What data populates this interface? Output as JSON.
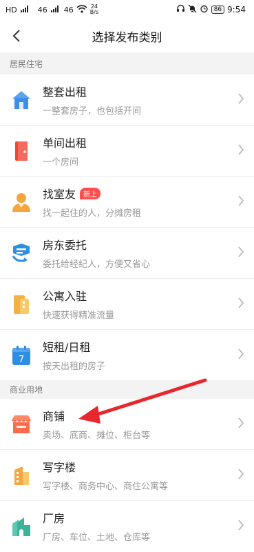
{
  "status_bar": {
    "left_labels": [
      "HD",
      "46",
      "46"
    ],
    "speed_value": "24",
    "speed_unit": "B/s",
    "battery": "86",
    "time": "9:54"
  },
  "header": {
    "title": "选择发布类别"
  },
  "sections": [
    {
      "title": "居民住宅",
      "items": [
        {
          "icon": "house-icon",
          "label": "整套出租",
          "sub": "一整套房子，也包括开间",
          "badge": ""
        },
        {
          "icon": "door-icon",
          "label": "单间出租",
          "sub": "一个房间",
          "badge": ""
        },
        {
          "icon": "person-icon",
          "label": "找室友",
          "sub": "找一起住的人，分摊房租",
          "badge": "新上"
        },
        {
          "icon": "handshake-icon",
          "label": "房东委托",
          "sub": "委托给经纪人，方便又省心",
          "badge": ""
        },
        {
          "icon": "apartment-icon",
          "label": "公寓入驻",
          "sub": "快速获得精准流量",
          "badge": ""
        },
        {
          "icon": "calendar-icon",
          "label": "短租/日租",
          "sub": "按天出租的房子",
          "badge": "",
          "calendar_number": "7"
        }
      ]
    },
    {
      "title": "商业用地",
      "items": [
        {
          "icon": "shop-icon",
          "label": "商铺",
          "sub": "卖场、底商、摊位、柜台等",
          "badge": ""
        },
        {
          "icon": "office-building-icon",
          "label": "写字楼",
          "sub": "写字楼、商务中心、商住公寓等",
          "badge": ""
        },
        {
          "icon": "factory-icon",
          "label": "厂房",
          "sub": "厂房、车位、土地、仓库等",
          "badge": ""
        }
      ]
    }
  ],
  "colors": {
    "house": "#3d8fe8",
    "door": "#e84a3a",
    "person": "#f4a53c",
    "handshake": "#2f8de4",
    "apartment": "#f5b043",
    "calendar": "#2f8de4",
    "shop": "#ff6b4a",
    "office": "#f5a742",
    "factory": "#3ab59c",
    "annotation_arrow": "#e8262e"
  }
}
